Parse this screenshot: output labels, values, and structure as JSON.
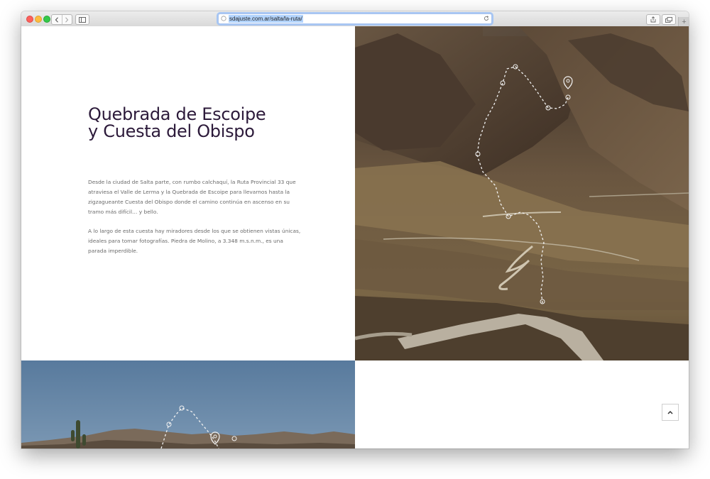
{
  "browser": {
    "url": "sdajuste.com.ar/salta/la-ruta/",
    "icons": [
      "close-icon",
      "minimize-icon",
      "zoom-icon",
      "back-icon",
      "forward-icon",
      "sidebar-icon",
      "globe-icon",
      "reload-icon",
      "share-icon",
      "tabs-icon",
      "plus-icon"
    ],
    "accent": "#a7c6f3"
  },
  "page": {
    "title_line1": "Quebrada de Escoipe",
    "title_line2": "y Cuesta del Obispo",
    "paragraph1": "Desde la ciudad de Salta parte, con rumbo calchaquí, la Ruta Provincial 33 que atraviesa el Valle de Lerma y la Quebrada de Escoipe para llevarnos hasta la zigzagueante Cuesta del Obispo donde el camino continúa en ascenso en su tramo más difícil… y bello.",
    "paragraph2": "A lo largo de esta cuesta hay miradores desde los que se obtienen vistas únicas, ideales para tomar fotografías. Piedra de Molino, a 3.348 m.s.n.m., es una parada imperdible.",
    "title_color": "#2c1a3a",
    "text_color": "#6b6b6b",
    "scroll_top_icon": "chevron-up-icon",
    "route_icons": [
      "route-dot-icon",
      "map-pin-icon"
    ]
  }
}
